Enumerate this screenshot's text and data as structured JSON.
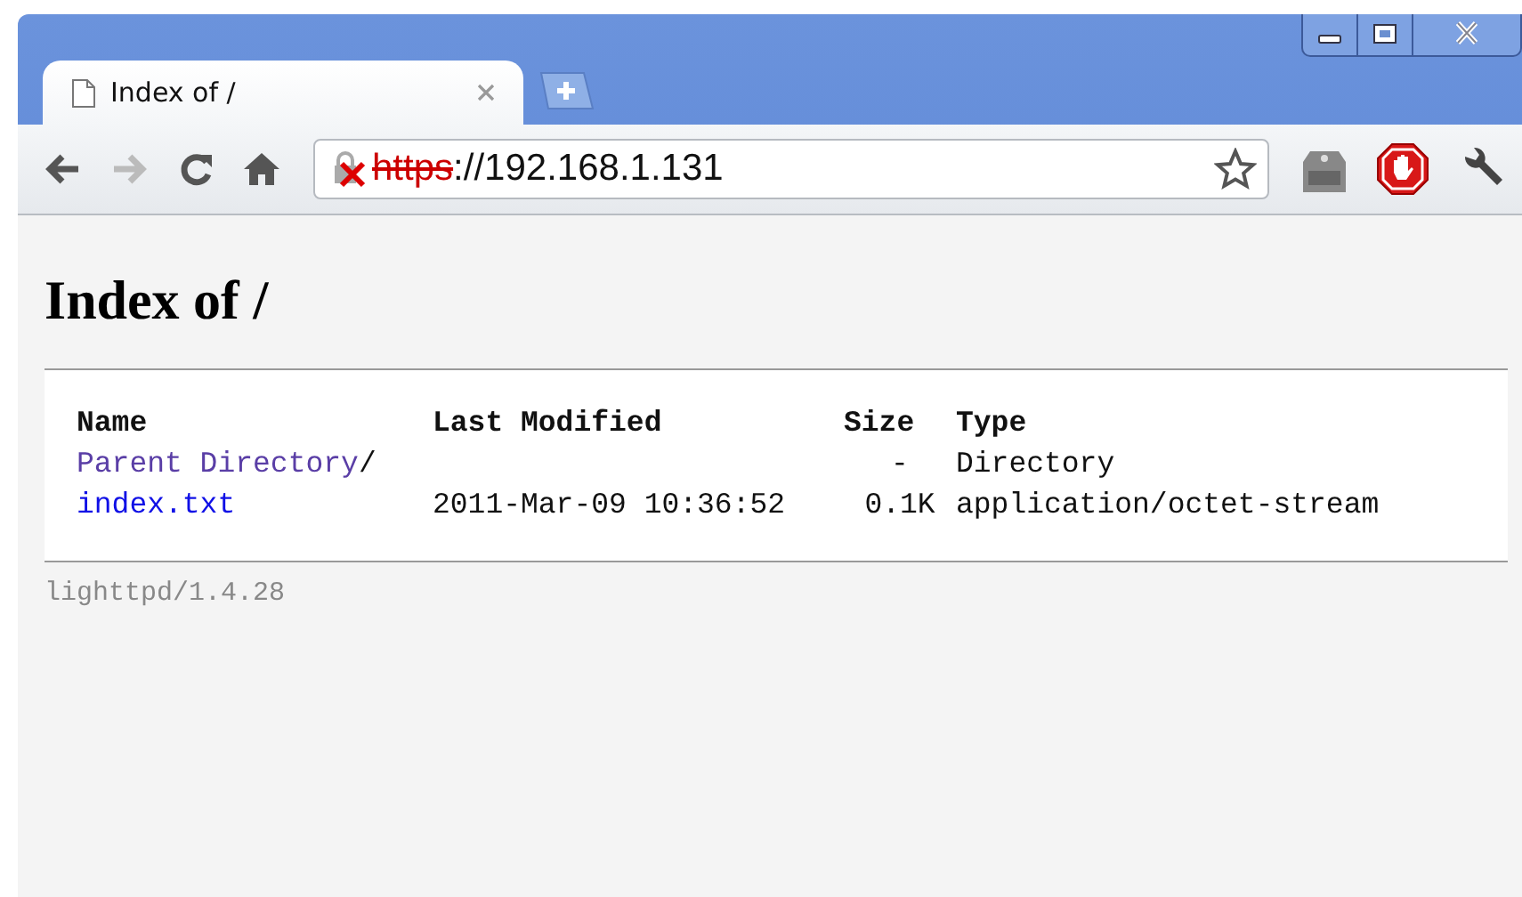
{
  "tabs": [
    {
      "title": "Index of /",
      "selected": true
    }
  ],
  "address": {
    "scheme": "https",
    "rest": "://192.168.1.131"
  },
  "page": {
    "heading": "Index of /",
    "columns": [
      "Name",
      "Last Modified",
      "Size",
      "Type"
    ],
    "rows": [
      {
        "name": "Parent Directory",
        "suffix": "/",
        "visited": true,
        "modified": "",
        "size": "-",
        "type": "Directory"
      },
      {
        "name": "index.txt",
        "suffix": "",
        "visited": false,
        "modified": "2011-Mar-09 10:36:52",
        "size": "0.1K",
        "type": "application/octet-stream"
      }
    ],
    "footer": "lighttpd/1.4.28"
  }
}
